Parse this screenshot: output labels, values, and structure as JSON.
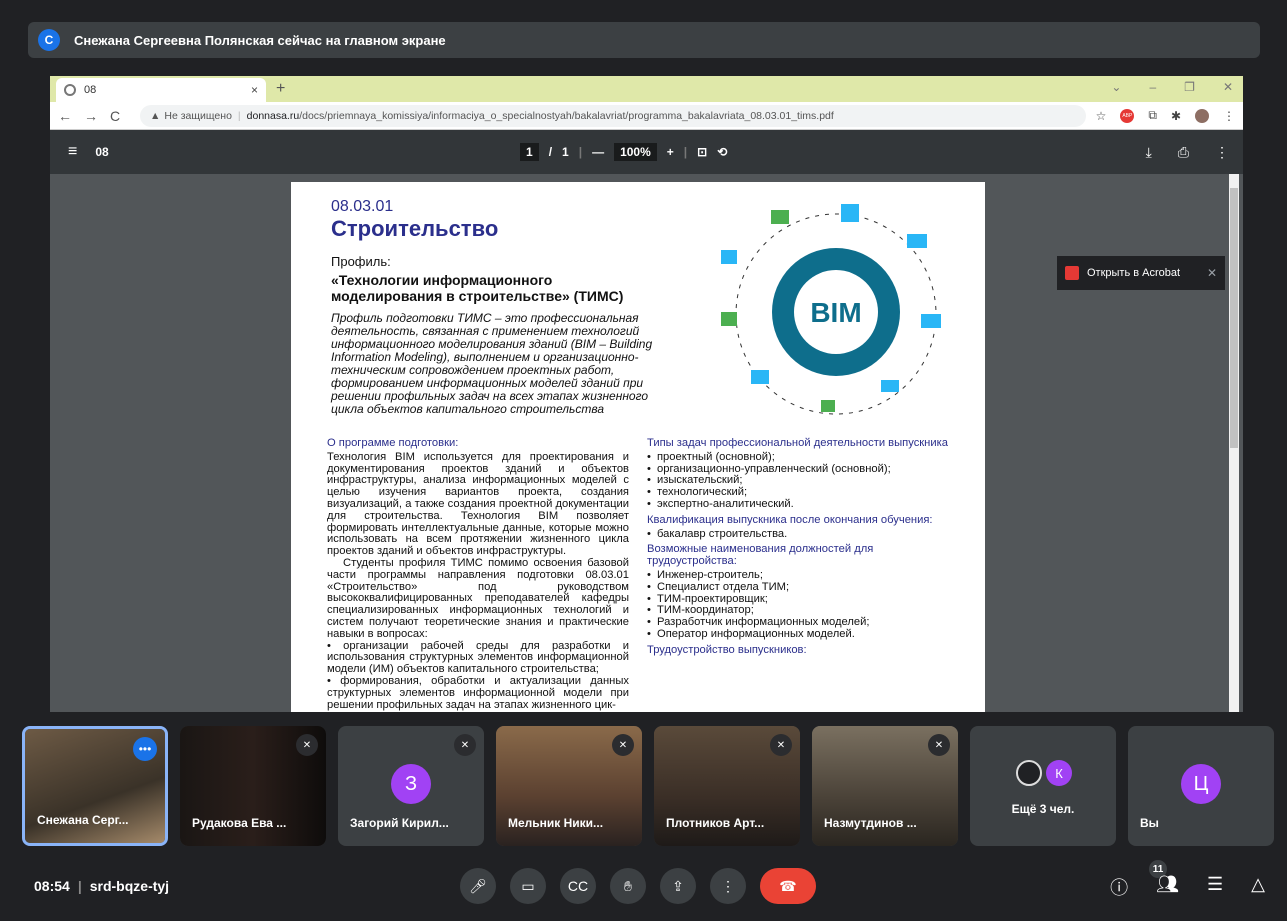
{
  "banner": {
    "avatar_letter": "С",
    "text": "Снежана Сергеевна Полянская сейчас на главном экране"
  },
  "browser": {
    "tab_title": "08",
    "tab_close": "×",
    "new_tab": "+",
    "security_label": "Не защищено",
    "url_domain": "donnasa.ru",
    "url_path": "/docs/priemnaya_komissiya/informaciya_o_specialnostyah/bakalavriat/programma_bakalavriata_08.03.01_tims.pdf"
  },
  "pdf": {
    "file_name": "08",
    "page_current": "1",
    "page_sep": "/",
    "page_total": "1",
    "zoom": "100%",
    "open_acrobat": "Открыть в Acrobat"
  },
  "document": {
    "code": "08.03.01",
    "title": "Строительство",
    "profile_label": "Профиль:",
    "profile_name": "«Технологии информационного моделирования в строительстве» (ТИМС)",
    "description": "Профиль подготовки ТИМС – это профессиональная деятельность, связанная с применением технологий информационного моделирования зданий (BIM – Building Information Modeling), выполнением и организационно-техническим сопровождением проектных работ, формированием информационных моделей зданий при решении профильных задач на всех этапах жизненного цикла объектов капитального строительства",
    "bim_text": "BIM",
    "about_heading": "О программе подготовки:",
    "about_text": "Технология BIM используется для проектирования и документирования проектов зданий и объектов инфраструктуры, анализа информационных моделей с целью изучения вариантов проекта, создания визуализаций, а также создания проектной документации для строительства. Технология BIM позволяет формировать интеллектуальные данные, которые можно использовать на всем протяжении жизненного цикла проектов зданий и объектов инфраструктуры.",
    "about_text2": "Студенты профиля ТИМС помимо освоения базовой части программы направления подготовки 08.03.01 «Строительство» под руководством высококвалифицированных преподавателей кафедры специализированных информационных технологий и систем получают теоретические знания и практические навыки в вопросах:",
    "about_bullet1": "• организации рабочей среды для разработки и использования структурных элементов информационной модели (ИМ) объектов капитального строительства;",
    "about_bullet2": "• формирования, обработки и актуализации данных структурных элементов информационной модели при решении профильных задач на этапах жизненного цик-",
    "tasks_heading": "Типы задач профессиональной деятельности выпускника",
    "tasks": [
      "проектный (основной);",
      "организационно-управленческий (основной);",
      "изыскательский;",
      "технологический;",
      "экспертно-аналитический."
    ],
    "qual_heading": "Квалификация выпускника после окончания обучения:",
    "qual": [
      "бакалавр строительства."
    ],
    "jobs_heading": "Возможные наименования должностей для трудоустройства:",
    "jobs": [
      "Инженер-строитель;",
      "Специалист отдела ТИМ;",
      "ТИМ-проектировщик;",
      "ТИМ-координатор;",
      "Разработчик информационных моделей;",
      "Оператор информационных моделей."
    ],
    "employ_heading": "Трудоустройство выпускников:"
  },
  "participants": [
    {
      "name": "Снежана Серг...",
      "letter": "",
      "color": ""
    },
    {
      "name": "Рудакова Ева ...",
      "letter": "",
      "color": ""
    },
    {
      "name": "Загорий Кирил...",
      "letter": "З",
      "color": "#a142f4"
    },
    {
      "name": "Мельник Ники...",
      "letter": "",
      "color": ""
    },
    {
      "name": "Плотников Арт...",
      "letter": "",
      "color": ""
    },
    {
      "name": "Назмутдинов ...",
      "letter": "",
      "color": ""
    },
    {
      "name": "Ещё 3 чел.",
      "letter": "К",
      "color": "#a142f4"
    },
    {
      "name": "Вы",
      "letter": "Ц",
      "color": "#a142f4"
    }
  ],
  "meeting": {
    "time": "08:54",
    "separator": "|",
    "code": "srd-bqze-tyj",
    "people_count": "11"
  }
}
